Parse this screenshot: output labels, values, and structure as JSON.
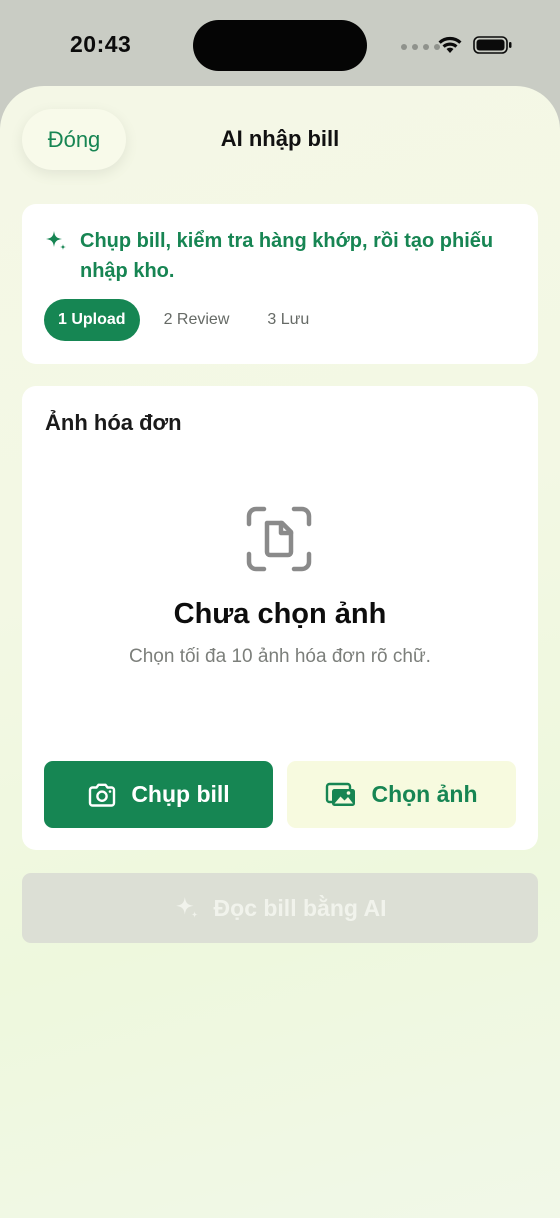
{
  "status_bar": {
    "time": "20:43"
  },
  "header": {
    "close_label": "Đóng",
    "title": "AI nhập bill"
  },
  "intro": {
    "text": "Chụp bill, kiểm tra hàng khớp, rồi tạo phiếu nhập kho.",
    "icon": "sparkle-icon"
  },
  "steps": [
    {
      "label": "1 Upload",
      "active": true
    },
    {
      "label": "2 Review",
      "active": false
    },
    {
      "label": "3 Lưu",
      "active": false
    }
  ],
  "upload": {
    "heading": "Ảnh hóa đơn",
    "empty_title": "Chưa chọn ảnh",
    "empty_subtitle": "Chọn tối đa 10 ảnh hóa đơn rõ chữ.",
    "capture_label": "Chụp bill",
    "pick_label": "Chọn ảnh"
  },
  "ai_action": {
    "label": "Đọc bill bằng AI",
    "enabled": false
  },
  "colors": {
    "accent": "#168653",
    "accent_text": "#178553",
    "disabled_bg": "#dcdfd5",
    "pick_bg": "#f7fadf"
  }
}
